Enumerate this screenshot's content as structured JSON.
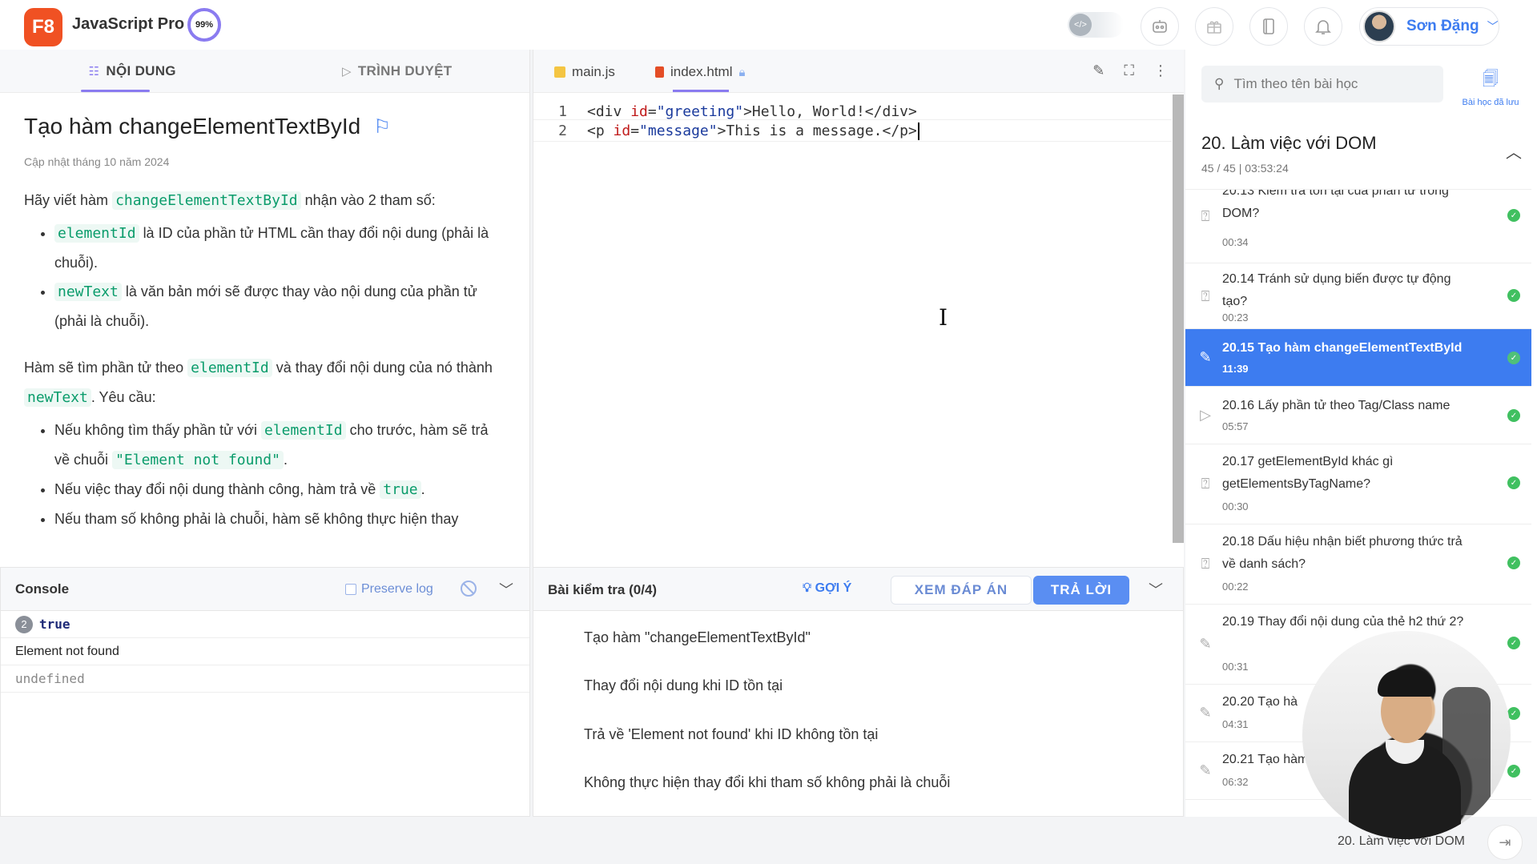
{
  "header": {
    "logo": "F8",
    "title": "JavaScript Pro",
    "progress": "99%",
    "user_name": "Sơn Đặng"
  },
  "left_panel": {
    "tabs": [
      {
        "label": "NỘI DUNG",
        "icon": "list-icon",
        "active": true
      },
      {
        "label": "TRÌNH DUYỆT",
        "icon": "play-icon",
        "active": false
      }
    ],
    "lesson_title": "Tạo hàm changeElementTextById",
    "updated": "Cập nhật tháng 10 năm 2024",
    "intro_pre": "Hãy viết hàm",
    "intro_code": "changeElementTextById",
    "intro_post": "nhận vào 2 tham số:",
    "params": [
      {
        "code": "elementId",
        "text": "là ID của phần tử HTML cần thay đổi nội dung (phải là chuỗi)."
      },
      {
        "code": "newText",
        "text": "là văn bản mới sẽ được thay vào nội dung của phần tử (phải là chuỗi)."
      }
    ],
    "desc_pre": "Hàm sẽ tìm phần tử theo",
    "desc_code1": "elementId",
    "desc_mid": "và thay đổi nội dung của nó thành",
    "desc_code2": "newText",
    "desc_post": ". Yêu cầu:",
    "req1_pre": "Nếu không tìm thấy phần tử với",
    "req1_code": "elementId",
    "req1_mid": "cho trước, hàm sẽ trả về chuỗi",
    "req1_code2": "\"Element not found\"",
    "req1_post": ".",
    "req2_pre": "Nếu việc thay đổi nội dung thành công, hàm trả về",
    "req2_code": "true",
    "req2_post": ".",
    "req3": "Nếu tham số không phải là chuỗi, hàm sẽ không thực hiện thay"
  },
  "console": {
    "title": "Console",
    "preserve_log": "Preserve log",
    "logs": [
      {
        "count": "2",
        "text": "true"
      },
      {
        "text": "Element not found"
      },
      {
        "text": "undefined"
      }
    ]
  },
  "editor": {
    "tabs": [
      {
        "label": "main.js",
        "icon": "js-file-icon"
      },
      {
        "label": "index.html",
        "icon": "html-file-icon",
        "active": true
      }
    ],
    "lines": [
      {
        "n": "1"
      },
      {
        "n": "2"
      }
    ],
    "line1": {
      "t1": "<div ",
      "a1": "id",
      "eq": "=",
      "s1": "\"greeting\"",
      "t2": ">Hello, World!</div>"
    },
    "line2": {
      "t1": "<p ",
      "a1": "id",
      "eq": "=",
      "s1": "\"message\"",
      "t2": ">This is a message.</p>"
    }
  },
  "quiz": {
    "title": "Bài kiểm tra (0/4)",
    "hint": "GỢI Ý",
    "view_answer": "XEM ĐÁP ÁN",
    "submit": "TRẢ LỜI",
    "items": [
      "Tạo hàm \"changeElementTextById\"",
      "Thay đổi nội dung khi ID tồn tại",
      "Trả về 'Element not found' khi ID không tồn tại",
      "Không thực hiện thay đổi khi tham số không phải là chuỗi"
    ]
  },
  "sidebar": {
    "search_placeholder": "Tìm theo tên bài học",
    "saved_label": "Bài học đã lưu",
    "chapter_title": "20. Làm việc với DOM",
    "chapter_meta": "45 / 45  |  03:53:24",
    "lessons": [
      {
        "title": "20.13 Kiểm tra tồn tại của phần tử trong DOM?",
        "time": "00:34",
        "icon": "quiz-icon",
        "done": true
      },
      {
        "title": "20.14 Tránh sử dụng biến được tự động tạo?",
        "time": "00:23",
        "icon": "quiz-icon",
        "done": true
      },
      {
        "title": "20.15 Tạo hàm changeElementTextById",
        "time": "11:39",
        "icon": "pencil-icon",
        "done": true,
        "active": true
      },
      {
        "title": "20.16 Lấy phần tử theo Tag/Class name",
        "time": "05:57",
        "icon": "play-icon",
        "done": true
      },
      {
        "title": "20.17 getElementById khác gì getElementsByTagName?",
        "time": "00:30",
        "icon": "quiz-icon",
        "done": true
      },
      {
        "title": "20.18 Dấu hiệu nhận biết phương thức trả về danh sách?",
        "time": "00:22",
        "icon": "quiz-icon",
        "done": true
      },
      {
        "title": "20.19 Thay đổi nội dung của thẻ h2 thứ 2?",
        "time": "00:31",
        "icon": "edit-icon",
        "done": true
      },
      {
        "title": "20.20 Tạo hà",
        "time": "04:31",
        "icon": "pencil-icon",
        "done": true
      },
      {
        "title": "20.21 Tạo hàm",
        "time": "06:32",
        "icon": "pencil-icon",
        "done": true
      }
    ]
  },
  "footer": {
    "chapter": "20. Làm việc với DOM"
  }
}
